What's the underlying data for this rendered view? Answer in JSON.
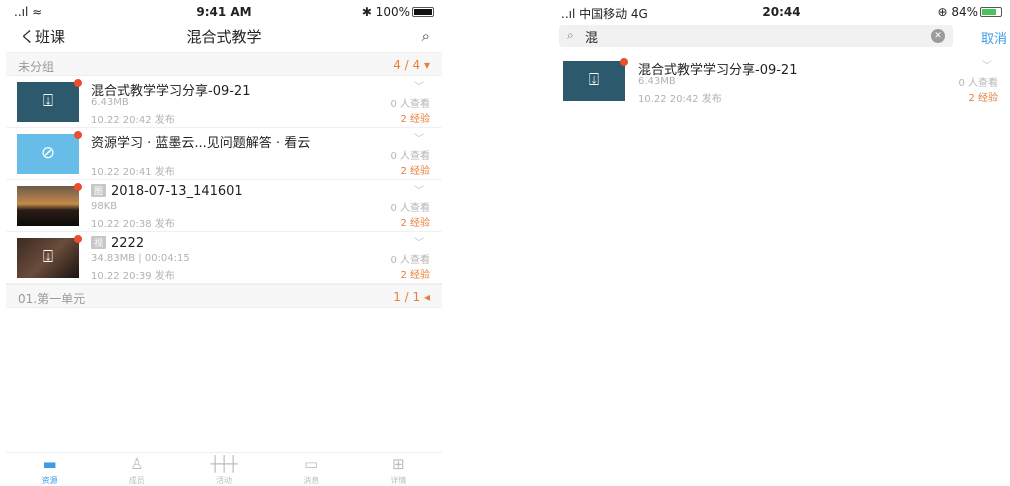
{
  "left": {
    "status": {
      "signal": "..ıl ≈",
      "time": "9:41 AM",
      "battery": "✱ 100%"
    },
    "nav": {
      "back": "く班课",
      "title": "混合式教学",
      "search_icon": "search-icon"
    },
    "groups": [
      {
        "name": "未分组",
        "count": "4 / 4 ▾"
      },
      {
        "name": "01.第一单元",
        "count": "1 / 1 ◂"
      }
    ],
    "items": [
      {
        "title": "混合式教学学习分享-09-21",
        "tag": "",
        "meta1": "6.43MB",
        "meta2": "10.22 20:42 发布",
        "views": "0 人查看",
        "exp": "2 经验",
        "thumb": "file-download-icon"
      },
      {
        "title": "资源学习 · 蓝墨云...见问题解答 · 看云",
        "tag": "",
        "meta1": "",
        "meta2": "10.22 20:41 发布",
        "views": "0 人查看",
        "exp": "2 经验",
        "thumb": "link-icon"
      },
      {
        "title": "2018-07-13_141601",
        "tag": "图",
        "meta1": "98KB",
        "meta2": "10.22 20:38 发布",
        "views": "0 人查看",
        "exp": "2 经验",
        "thumb": "image-thumb"
      },
      {
        "title": "2222",
        "tag": "视",
        "meta1": "34.83MB | 00:04:15",
        "meta2": "10.22 20:39 发布",
        "views": "0 人查看",
        "exp": "2 经验",
        "thumb": "video-thumb"
      }
    ],
    "tabs": [
      {
        "label": "资源",
        "icon": "folder-icon"
      },
      {
        "label": "成员",
        "icon": "members-icon"
      },
      {
        "label": "活动",
        "icon": "activity-icon"
      },
      {
        "label": "消息",
        "icon": "message-icon"
      },
      {
        "label": "详情",
        "icon": "details-icon"
      }
    ]
  },
  "right": {
    "status": {
      "carrier": "..ıl 中国移动  4G",
      "time": "20:44",
      "battery": "⊕ 84%"
    },
    "search": {
      "value": "混",
      "cancel": "取消"
    },
    "item": {
      "title": "混合式教学学习分享-09-21",
      "meta1": "6.43MB",
      "meta2": "10.22 20:42 发布",
      "views": "0 人查看",
      "exp": "2 经验"
    }
  }
}
